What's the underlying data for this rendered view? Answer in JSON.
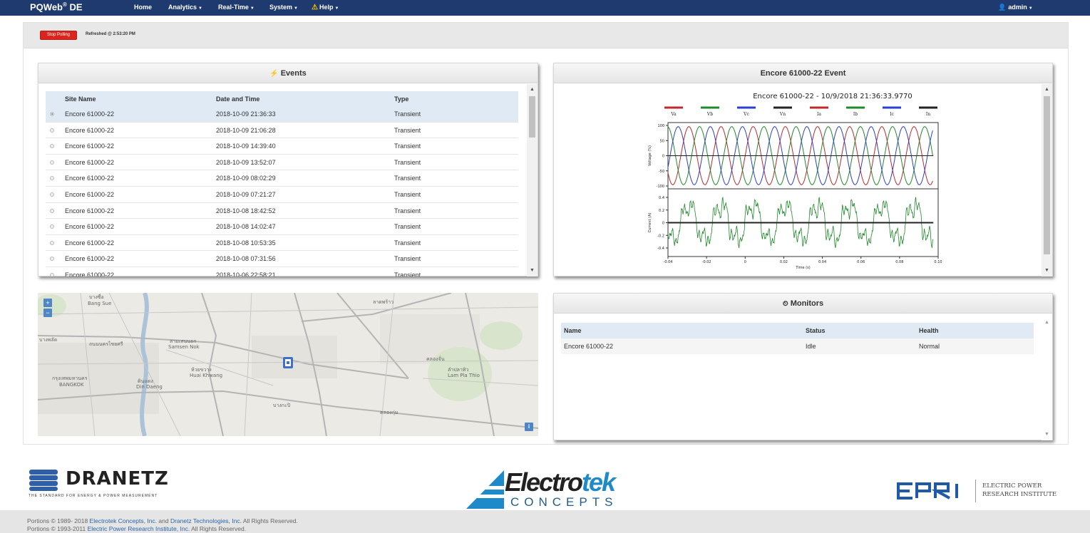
{
  "nav": {
    "brand": "PQWeb",
    "brand_sup": "®",
    "brand_suffix": " DE",
    "items": [
      {
        "label": "Home"
      },
      {
        "label": "Analytics"
      },
      {
        "label": "Real-Time"
      },
      {
        "label": "System"
      },
      {
        "label": "Help"
      }
    ],
    "user": "admin"
  },
  "polling": {
    "stop_label": "Stop Polling",
    "refreshed": "Refreshed @ 2:53:20 PM"
  },
  "events": {
    "title": "Events",
    "columns": [
      "Site Name",
      "Date and Time",
      "Type"
    ],
    "rows": [
      {
        "site": "Encore 61000-22",
        "datetime": "2018-10-09 21:36:33",
        "type": "Transient",
        "selected": true
      },
      {
        "site": "Encore 61000-22",
        "datetime": "2018-10-09 21:06:28",
        "type": "Transient"
      },
      {
        "site": "Encore 61000-22",
        "datetime": "2018-10-09 14:39:40",
        "type": "Transient"
      },
      {
        "site": "Encore 61000-22",
        "datetime": "2018-10-09 13:52:07",
        "type": "Transient"
      },
      {
        "site": "Encore 61000-22",
        "datetime": "2018-10-09 08:02:29",
        "type": "Transient"
      },
      {
        "site": "Encore 61000-22",
        "datetime": "2018-10-09 07:21:27",
        "type": "Transient"
      },
      {
        "site": "Encore 61000-22",
        "datetime": "2018-10-08 18:42:52",
        "type": "Transient"
      },
      {
        "site": "Encore 61000-22",
        "datetime": "2018-10-08 14:02:47",
        "type": "Transient"
      },
      {
        "site": "Encore 61000-22",
        "datetime": "2018-10-08 10:53:35",
        "type": "Transient"
      },
      {
        "site": "Encore 61000-22",
        "datetime": "2018-10-08 07:31:56",
        "type": "Transient"
      },
      {
        "site": "Encore 61000-22",
        "datetime": "2018-10-06 22:58:21",
        "type": "Transient"
      }
    ]
  },
  "event_chart": {
    "panel_title": "Encore 61000-22 Event",
    "chart_title": "Encore 61000-22 - 10/9/2018 21:36:33.9770",
    "legend": [
      {
        "name": "Va",
        "color": "#c0282d"
      },
      {
        "name": "Vb",
        "color": "#1f8a2a"
      },
      {
        "name": "Vc",
        "color": "#2a3fcf"
      },
      {
        "name": "Vn",
        "color": "#222222"
      },
      {
        "name": "Ia",
        "color": "#c0282d"
      },
      {
        "name": "Ib",
        "color": "#1f8a2a"
      },
      {
        "name": "Ic",
        "color": "#2a3fcf"
      },
      {
        "name": "In",
        "color": "#222222"
      }
    ],
    "voltage_ylabel": "Voltage (%)",
    "current_ylabel": "Current (A)",
    "xlabel": "Time (s)",
    "voltage_ticks": [
      "100",
      "50",
      "0",
      "-50",
      "-100"
    ],
    "current_ticks": [
      "0.4",
      "0.2",
      "0",
      "-0.2",
      "-0.4"
    ],
    "x_ticks": [
      "-0.04",
      "-0.02",
      "0",
      "0.02",
      "0.04",
      "0.06",
      "0.08",
      "0.10"
    ]
  },
  "map": {
    "labels": [
      "บางซื่อ",
      "Bang Sue",
      "บางพลัด",
      "ถนนนครไชยศรี",
      "สามเสนนอก",
      "Samsen Nok",
      "กรุงเทพมหานคร",
      "BANGKOK",
      "ดินแดง",
      "Din Daeng",
      "ห้วยขวาง",
      "Huai Khwang",
      "ลาดพร้าว",
      "คลองจั่น",
      "คลองกุ่ม",
      "ลำปลาทิว",
      "Lam Pla Thio",
      "บางกะปิ"
    ],
    "zoom_in": "+",
    "zoom_out": "−",
    "info": "i"
  },
  "monitors": {
    "title": "Monitors",
    "columns": [
      "Name",
      "Status",
      "Health"
    ],
    "rows": [
      {
        "name": "Encore 61000-22",
        "status": "Idle",
        "health": "Normal"
      }
    ]
  },
  "footer": {
    "dranetz_name": "DRANETZ",
    "dranetz_tag": "THE STANDARD FOR ENERGY & POWER MEASUREMENT",
    "electrotek_name": "Electro",
    "electrotek_name2": "tek",
    "electrotek_sub": "CONCEPTS",
    "epri_line1": "ELECTRIC POWER",
    "epri_line2": "RESEARCH INSTITUTE",
    "copy1_a": "Portions © 1989- 2018 ",
    "copy1_b": "Electrotek Concepts, Inc.",
    "copy1_c": " and ",
    "copy1_d": "Dranetz Technologies, Inc.",
    "copy1_e": " All Rights Reserved.",
    "copy2_a": "Portions © 1993-2011 ",
    "copy2_b": "Electric Power Research Institute, Inc.",
    "copy2_c": " All Rights Reserved."
  },
  "colors": {
    "navbar": "#1f3a6e",
    "stop_button": "#d9251d",
    "table_header": "#dfeaf4",
    "link": "#2a64a8"
  }
}
